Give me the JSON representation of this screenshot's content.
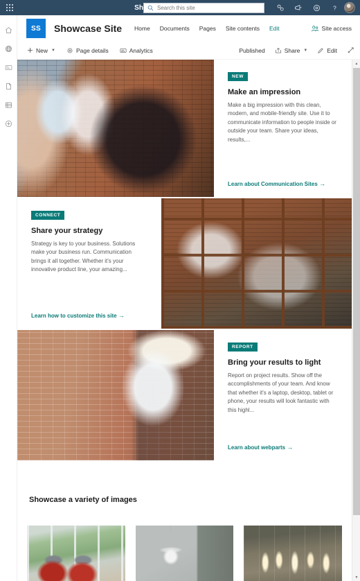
{
  "suite_bar": {
    "waffle_label": "app-launcher",
    "brand": "SharePoint",
    "search": {
      "placeholder": "Search this site",
      "value": ""
    },
    "icons": [
      {
        "name": "sharepoint-apps-icon",
        "glyph": "⚉"
      },
      {
        "name": "feedback-megaphone-icon",
        "glyph": "⬖"
      },
      {
        "name": "settings-gear-icon",
        "glyph": "⚙"
      },
      {
        "name": "help-icon",
        "glyph": "?"
      }
    ],
    "avatar_label": "user-avatar"
  },
  "rail": {
    "items": [
      {
        "name": "home-icon",
        "label": "Home"
      },
      {
        "name": "globe-network-icon",
        "label": "SharePoint start"
      },
      {
        "name": "news-icon",
        "label": "News"
      },
      {
        "name": "document-icon",
        "label": "Documents"
      },
      {
        "name": "list-library-icon",
        "label": "Lists"
      },
      {
        "name": "create-plus-icon",
        "label": "Create"
      }
    ]
  },
  "site_header": {
    "logo_initials": "SS",
    "logo_color": "#0f7ad4",
    "title": "Showcase Site",
    "nav": [
      {
        "label": "Home",
        "active": false
      },
      {
        "label": "Documents",
        "active": false
      },
      {
        "label": "Pages",
        "active": false
      },
      {
        "label": "Site contents",
        "active": false
      },
      {
        "label": "Edit",
        "active": true
      }
    ],
    "site_access_label": "Site access",
    "accent_color": "#0b7b78"
  },
  "command_bar": {
    "new_label": "New",
    "page_details_label": "Page details",
    "analytics_label": "Analytics",
    "published_label": "Published",
    "share_label": "Share",
    "edit_label": "Edit",
    "fullscreen_label": "full-screen"
  },
  "hero": {
    "cards": [
      {
        "badge": "NEW",
        "title": "Make an impression",
        "description": "Make a big impression with this clean, modern, and mobile-friendly site. Use it to communicate information to people inside or outside your team. Share your ideas, results,...",
        "link": "Learn about Communication Sites",
        "link_arrow": "→",
        "image_name": "office-meeting-photo",
        "layout": "image-left"
      },
      {
        "badge": "CONNECT",
        "title": "Share your strategy",
        "description": "Strategy is key to your business. Solutions make your business run. Communication brings it all together. Whether it's your innovative product line, your amazing...",
        "link": "Learn how to customize this site",
        "link_arrow": "→",
        "image_name": "glass-conference-room-photo",
        "layout": "image-right"
      },
      {
        "badge": "REPORT",
        "title": "Bring your results to light",
        "description": "Report on project results. Show off the accomplishments of your team. And know that whether it's a laptop, desktop, tablet or phone, your results will look fantastic with this highl...",
        "link": "Learn about webparts",
        "link_arrow": "→",
        "image_name": "brick-wall-entryway-photo",
        "layout": "image-left"
      }
    ]
  },
  "gallery": {
    "heading": "Showcase a variety of images",
    "thumbnails": [
      {
        "name": "red-chairs-lounge-thumbnail"
      },
      {
        "name": "pendant-lamp-thumbnail"
      },
      {
        "name": "office-lighting-thumbnail"
      }
    ]
  },
  "scrollbar": {
    "up_arrow": "▲",
    "down_arrow": "▼"
  }
}
